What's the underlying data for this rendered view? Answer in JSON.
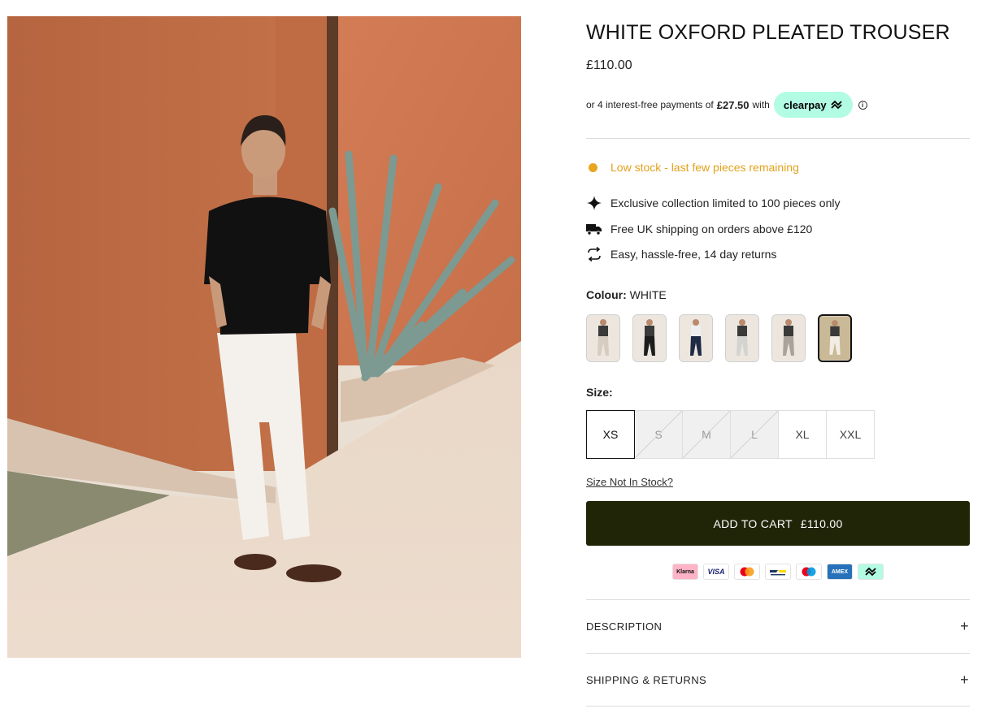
{
  "product": {
    "title": "WHITE OXFORD PLEATED TROUSER",
    "price": "£110.00",
    "image_alt": "Model wearing white oxford pleated trousers with black knit polo"
  },
  "clearpay": {
    "text_before": "or 4 interest-free payments of",
    "amount": "£27.50",
    "text_after": "with",
    "brand": "clearpay",
    "info_icon": "ⓘ"
  },
  "stock": {
    "message": "Low stock - last few pieces remaining",
    "color": "#e8a51d"
  },
  "features": [
    {
      "icon": "sparkle-icon",
      "text": "Exclusive collection limited to 100 pieces only"
    },
    {
      "icon": "truck-icon",
      "text": "Free UK shipping on orders above £120"
    },
    {
      "icon": "returns-icon",
      "text": "Easy, hassle-free, 14 day returns"
    }
  ],
  "colour": {
    "label": "Colour:",
    "value": "WHITE",
    "swatches": [
      {
        "name": "beige",
        "pant_color": "#d6ccbf"
      },
      {
        "name": "black",
        "pant_color": "#1c1c1c"
      },
      {
        "name": "navy",
        "pant_color": "#1f2a44"
      },
      {
        "name": "light-grey",
        "pant_color": "#d3d3d0"
      },
      {
        "name": "grey",
        "pant_color": "#a9a39a"
      },
      {
        "name": "white",
        "pant_color": "#f1ede4",
        "selected": true
      }
    ]
  },
  "size": {
    "label": "Size:",
    "options": [
      {
        "label": "XS",
        "selected": true,
        "in_stock": true
      },
      {
        "label": "S",
        "selected": false,
        "in_stock": false
      },
      {
        "label": "M",
        "selected": false,
        "in_stock": false
      },
      {
        "label": "L",
        "selected": false,
        "in_stock": false
      },
      {
        "label": "XL",
        "selected": false,
        "in_stock": true
      },
      {
        "label": "XXL",
        "selected": false,
        "in_stock": true
      }
    ],
    "not_in_stock_link": "Size Not In Stock?"
  },
  "cart": {
    "label": "ADD TO CART",
    "price": "£110.00",
    "color": "#212508"
  },
  "payments": [
    {
      "name": "klarna",
      "label": "Klarna"
    },
    {
      "name": "visa",
      "label": "VISA"
    },
    {
      "name": "mastercard",
      "label": ""
    },
    {
      "name": "bancontact",
      "label": ""
    },
    {
      "name": "maestro",
      "label": ""
    },
    {
      "name": "amex",
      "label": "AMEX"
    },
    {
      "name": "clearpay",
      "label": ""
    }
  ],
  "accordions": [
    {
      "label": "DESCRIPTION",
      "icon": "+"
    },
    {
      "label": "SHIPPING & RETURNS",
      "icon": "+"
    }
  ]
}
